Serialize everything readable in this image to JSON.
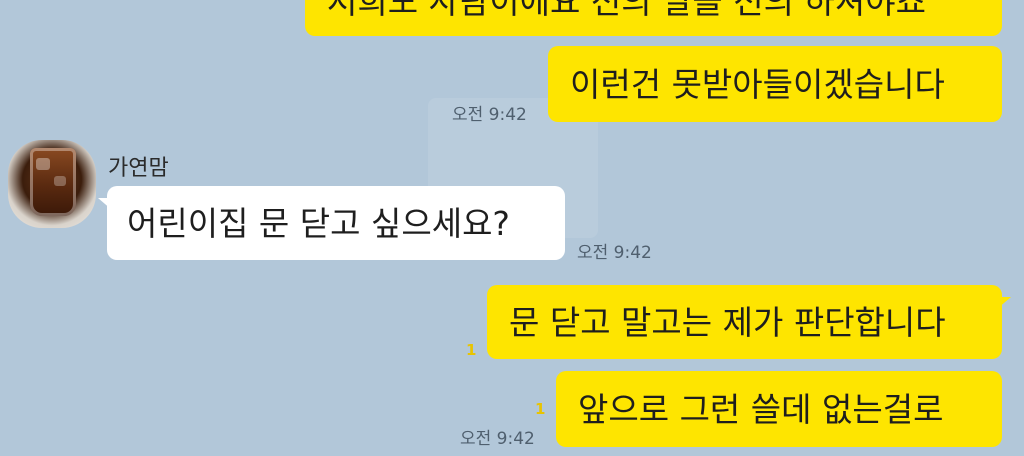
{
  "messages": [
    {
      "sender": "me",
      "text": "저희도 사람이에요 선의 말을 선의 하셔야죠",
      "time": ""
    },
    {
      "sender": "me",
      "text": "이런건 못받아들이겠습니다",
      "time": "오전 9:42"
    },
    {
      "sender": "가연맘",
      "text": "어린이집 문 닫고 싶으세요?",
      "time": "오전 9:42"
    },
    {
      "sender": "me",
      "text": "문 닫고 말고는 제가 판단합니다",
      "unread": "1",
      "time": ""
    },
    {
      "sender": "me",
      "text": "앞으로 그런 쓸데 없는걸로",
      "unread": "1",
      "time": "오전 9:42"
    }
  ],
  "colors": {
    "background": "#b2c7d9",
    "my_bubble": "#fee500",
    "their_bubble": "#ffffff"
  }
}
